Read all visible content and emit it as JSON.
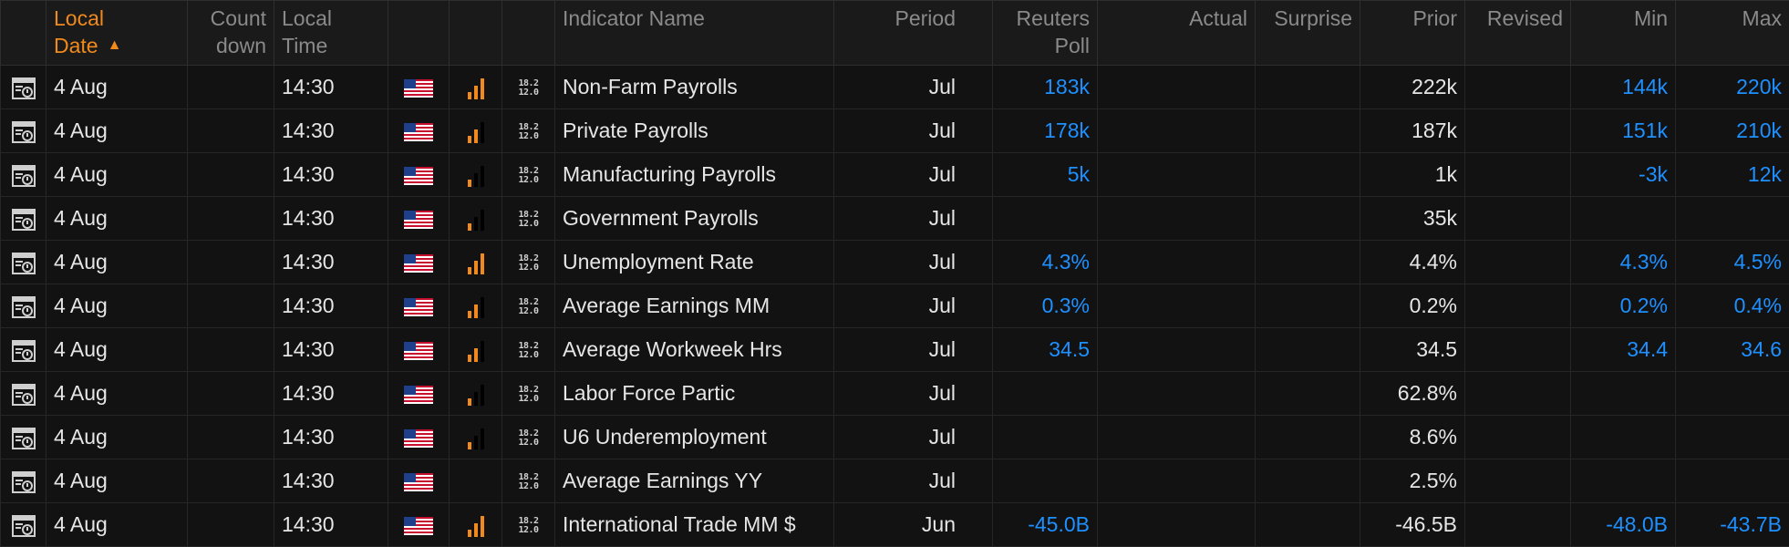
{
  "columns": {
    "local_date_1": "Local",
    "local_date_2": "Date",
    "countdown_1": "Count",
    "countdown_2": "down",
    "local_time_1": "Local",
    "local_time_2": "Time",
    "indicator_name": "Indicator Name",
    "period": "Period",
    "reuters_poll_1": "Reuters",
    "reuters_poll_2": "Poll",
    "actual": "Actual",
    "surprise": "Surprise",
    "prior": "Prior",
    "revised": "Revised",
    "min": "Min",
    "max": "Max"
  },
  "sort": {
    "column": "Local Date",
    "direction": "ascending",
    "color": "#f08a1c"
  },
  "colors": {
    "forecast_blue": "#1e90ff",
    "accent_orange": "#f08a1c"
  },
  "rows": [
    {
      "date": "4 Aug",
      "countdown": "",
      "time": "14:30",
      "country_icon": "us-flag-icon",
      "importance": 3,
      "name": "Non-Farm Payrolls",
      "period": "Jul",
      "poll": "183k",
      "actual": "",
      "surprise": "",
      "prior": "222k",
      "revised": "",
      "min": "144k",
      "max": "220k"
    },
    {
      "date": "4 Aug",
      "countdown": "",
      "time": "14:30",
      "country_icon": "us-flag-icon",
      "importance": 2,
      "name": "Private Payrolls",
      "period": "Jul",
      "poll": "178k",
      "actual": "",
      "surprise": "",
      "prior": "187k",
      "revised": "",
      "min": "151k",
      "max": "210k"
    },
    {
      "date": "4 Aug",
      "countdown": "",
      "time": "14:30",
      "country_icon": "us-flag-icon",
      "importance": 1,
      "name": "Manufacturing Payrolls",
      "period": "Jul",
      "poll": "5k",
      "actual": "",
      "surprise": "",
      "prior": "1k",
      "revised": "",
      "min": "-3k",
      "max": "12k"
    },
    {
      "date": "4 Aug",
      "countdown": "",
      "time": "14:30",
      "country_icon": "us-flag-icon",
      "importance": 1,
      "name": "Government Payrolls",
      "period": "Jul",
      "poll": "",
      "actual": "",
      "surprise": "",
      "prior": "35k",
      "revised": "",
      "min": "",
      "max": ""
    },
    {
      "date": "4 Aug",
      "countdown": "",
      "time": "14:30",
      "country_icon": "us-flag-icon",
      "importance": 3,
      "name": "Unemployment Rate",
      "period": "Jul",
      "poll": "4.3%",
      "actual": "",
      "surprise": "",
      "prior": "4.4%",
      "revised": "",
      "min": "4.3%",
      "max": "4.5%"
    },
    {
      "date": "4 Aug",
      "countdown": "",
      "time": "14:30",
      "country_icon": "us-flag-icon",
      "importance": 2,
      "name": "Average Earnings MM",
      "period": "Jul",
      "poll": "0.3%",
      "actual": "",
      "surprise": "",
      "prior": "0.2%",
      "revised": "",
      "min": "0.2%",
      "max": "0.4%"
    },
    {
      "date": "4 Aug",
      "countdown": "",
      "time": "14:30",
      "country_icon": "us-flag-icon",
      "importance": 2,
      "name": "Average Workweek Hrs",
      "period": "Jul",
      "poll": "34.5",
      "actual": "",
      "surprise": "",
      "prior": "34.5",
      "revised": "",
      "min": "34.4",
      "max": "34.6"
    },
    {
      "date": "4 Aug",
      "countdown": "",
      "time": "14:30",
      "country_icon": "us-flag-icon",
      "importance": 1,
      "name": "Labor Force Partic",
      "period": "Jul",
      "poll": "",
      "actual": "",
      "surprise": "",
      "prior": "62.8%",
      "revised": "",
      "min": "",
      "max": ""
    },
    {
      "date": "4 Aug",
      "countdown": "",
      "time": "14:30",
      "country_icon": "us-flag-icon",
      "importance": 1,
      "name": "U6 Underemployment",
      "period": "Jul",
      "poll": "",
      "actual": "",
      "surprise": "",
      "prior": "8.6%",
      "revised": "",
      "min": "",
      "max": ""
    },
    {
      "date": "4 Aug",
      "countdown": "",
      "time": "14:30",
      "country_icon": "us-flag-icon",
      "importance": 0,
      "name": "Average Earnings YY",
      "period": "Jul",
      "poll": "",
      "actual": "",
      "surprise": "",
      "prior": "2.5%",
      "revised": "",
      "min": "",
      "max": ""
    },
    {
      "date": "4 Aug",
      "countdown": "",
      "time": "14:30",
      "country_icon": "us-flag-icon",
      "importance": 3,
      "name": "International Trade MM $",
      "period": "Jun",
      "poll": "-45.0B",
      "actual": "",
      "surprise": "",
      "prior": "-46.5B",
      "revised": "",
      "min": "-48.0B",
      "max": "-43.7B"
    }
  ]
}
